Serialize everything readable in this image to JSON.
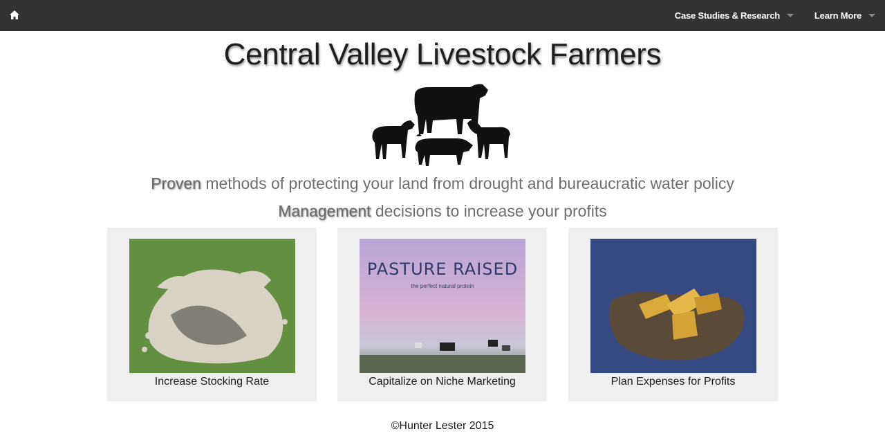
{
  "nav": {
    "home_icon": "home-icon",
    "items": [
      {
        "label": "Case Studies & Research"
      },
      {
        "label": "Learn More"
      }
    ]
  },
  "page": {
    "title": "Central Valley Livestock Farmers",
    "logo_icon": "livestock-silhouette-logo"
  },
  "taglines": [
    {
      "emphasis": "Proven",
      "rest": " methods of protecting your land from drought and bureaucratic water policy"
    },
    {
      "emphasis": "Management",
      "rest": " decisions to increase your profits"
    }
  ],
  "cards": [
    {
      "label": "Increase Stocking Rate",
      "image": "sheep-flock-aerial-photo"
    },
    {
      "label": "Capitalize on Niche Marketing",
      "image": "pasture-raised-photo",
      "image_title": "PASTURE RAISED",
      "image_subtitle": "the perfect natural protein"
    },
    {
      "label": "Plan Expenses for Profits",
      "image": "gold-bars-in-hands-photo"
    }
  ],
  "footer": {
    "text": "©Hunter Lester 2015"
  },
  "colors": {
    "navbar": "#333333",
    "card_bg": "#efefef",
    "tagline": "#6e6e6e"
  }
}
